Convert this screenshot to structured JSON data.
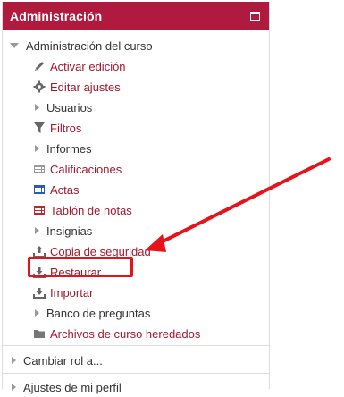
{
  "block": {
    "title": "Administración"
  },
  "tree": {
    "root_label": "Administración del curso",
    "items": [
      {
        "label": "Activar edición",
        "icon": "pencil-icon",
        "type": "link"
      },
      {
        "label": "Editar ajustes",
        "icon": "gear-icon",
        "type": "link"
      },
      {
        "label": "Usuarios",
        "icon": "caret-right-icon",
        "type": "branch"
      },
      {
        "label": "Filtros",
        "icon": "filter-icon",
        "type": "link"
      },
      {
        "label": "Informes",
        "icon": "caret-right-icon",
        "type": "branch"
      },
      {
        "label": "Calificaciones",
        "icon": "table-icon",
        "type": "link"
      },
      {
        "label": "Actas",
        "icon": "table-blue-icon",
        "type": "link"
      },
      {
        "label": "Tablón de notas",
        "icon": "table-red-icon",
        "type": "link"
      },
      {
        "label": "Insignias",
        "icon": "caret-right-icon",
        "type": "branch"
      },
      {
        "label": "Copia de seguridad",
        "icon": "backup-icon",
        "type": "link"
      },
      {
        "label": "Restaurar",
        "icon": "restore-icon",
        "type": "link"
      },
      {
        "label": "Importar",
        "icon": "import-icon",
        "type": "link"
      },
      {
        "label": "Banco de preguntas",
        "icon": "caret-right-icon",
        "type": "branch"
      },
      {
        "label": "Archivos de curso heredados",
        "icon": "folder-icon",
        "type": "link"
      }
    ],
    "bottom_items": [
      {
        "label": "Cambiar rol a...",
        "icon": "caret-right-icon"
      },
      {
        "label": "Ajustes de mi perfil",
        "icon": "caret-right-icon"
      }
    ]
  },
  "colors": {
    "header_bg": "#b01a3e",
    "link": "#a3182e",
    "annotation": "#e8131a"
  }
}
